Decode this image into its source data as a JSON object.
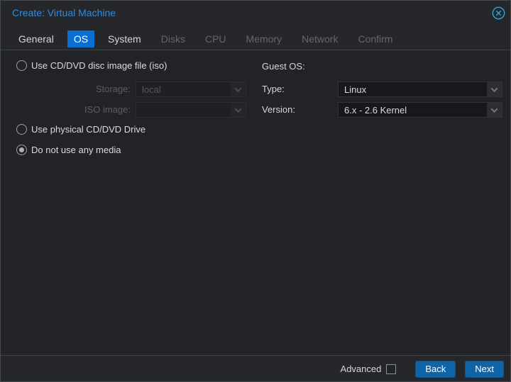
{
  "dialog": {
    "title": "Create: Virtual Machine"
  },
  "tabs": [
    {
      "label": "General",
      "state": "enabled"
    },
    {
      "label": "OS",
      "state": "active"
    },
    {
      "label": "System",
      "state": "enabled"
    },
    {
      "label": "Disks",
      "state": "disabled"
    },
    {
      "label": "CPU",
      "state": "disabled"
    },
    {
      "label": "Memory",
      "state": "disabled"
    },
    {
      "label": "Network",
      "state": "disabled"
    },
    {
      "label": "Confirm",
      "state": "disabled"
    }
  ],
  "media": {
    "options": [
      {
        "label": "Use CD/DVD disc image file (iso)",
        "selected": false
      },
      {
        "label": "Use physical CD/DVD Drive",
        "selected": false
      },
      {
        "label": "Do not use any media",
        "selected": true
      }
    ],
    "storage": {
      "label": "Storage:",
      "value": "local",
      "disabled": true
    },
    "iso": {
      "label": "ISO image:",
      "value": "",
      "disabled": true
    }
  },
  "guest_os": {
    "heading": "Guest OS:",
    "type": {
      "label": "Type:",
      "value": "Linux"
    },
    "version": {
      "label": "Version:",
      "value": "6.x - 2.6 Kernel"
    }
  },
  "footer": {
    "advanced_label": "Advanced",
    "advanced_checked": false,
    "back_label": "Back",
    "next_label": "Next"
  },
  "colors": {
    "title_text": "#2e8be0",
    "active_tab_bg": "#0a6fd2",
    "button_bg": "#0f64a8",
    "close_icon": "#2aa8e0",
    "dialog_bg": "#26272b",
    "content_bg": "#222327"
  }
}
